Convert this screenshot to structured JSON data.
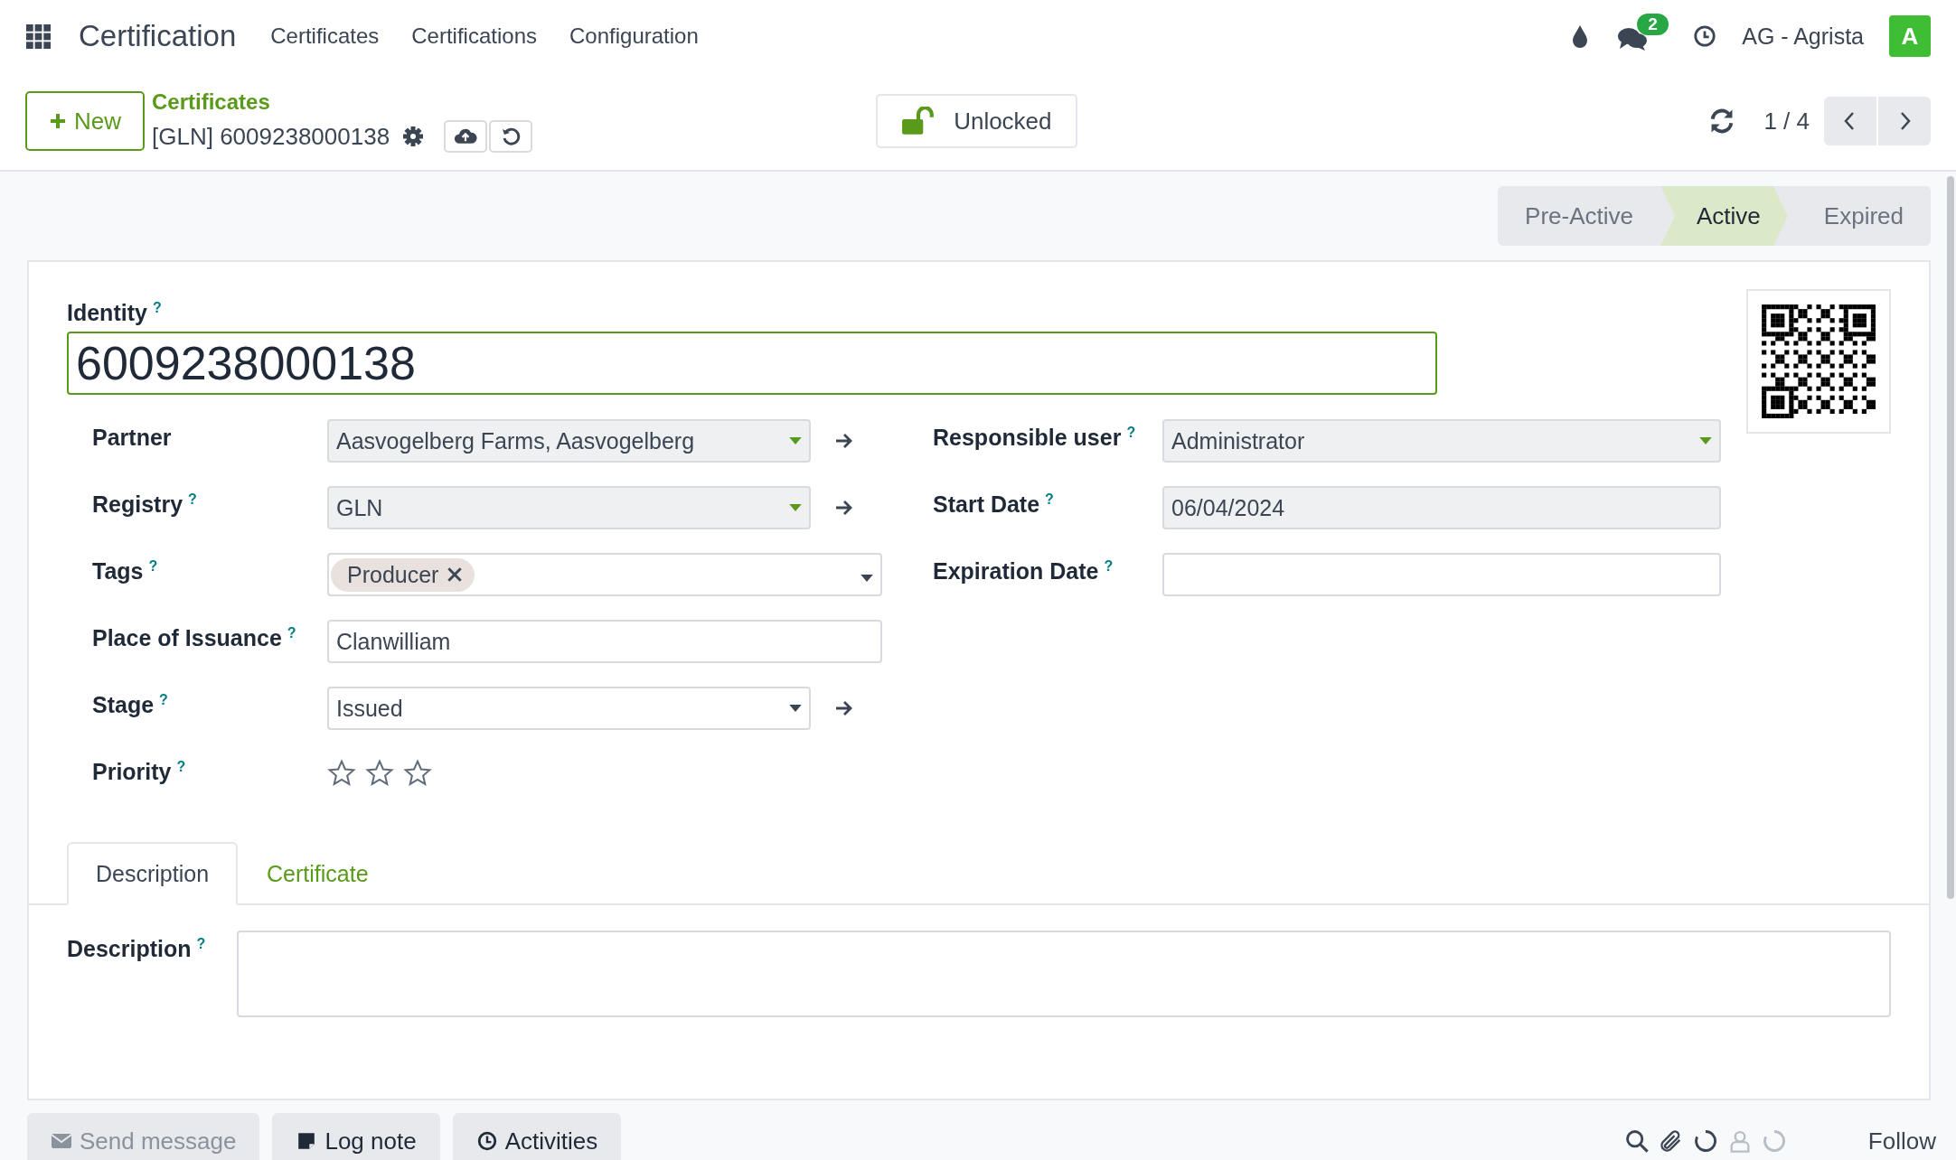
{
  "nav": {
    "app_name": "Certification",
    "menu": [
      "Certificates",
      "Certifications",
      "Configuration"
    ],
    "message_count": "2",
    "company": "AG - Agrista",
    "avatar_letter": "A"
  },
  "control_panel": {
    "new_button": "New",
    "breadcrumb": "Certificates",
    "record_name": "[GLN] 6009238000138",
    "lock_button": "Unlocked",
    "pager": "1 / 4"
  },
  "stages": [
    {
      "label": "Pre-Active",
      "selected": false
    },
    {
      "label": "Active",
      "selected": true
    },
    {
      "label": "Expired",
      "selected": false
    }
  ],
  "identity": {
    "label": "Identity",
    "help": "?",
    "value": "6009238000138"
  },
  "fields_left": [
    {
      "kind": "many2one",
      "label": "Partner",
      "value": "Aasvogelberg Farms, Aasvogelberg",
      "required": true,
      "open_link": true
    },
    {
      "kind": "many2one",
      "label": "Registry",
      "help": "?",
      "value": "GLN",
      "required": true,
      "open_link": true
    },
    {
      "kind": "tags",
      "label": "Tags",
      "help": "?",
      "tags": [
        "Producer"
      ]
    },
    {
      "kind": "text",
      "label": "Place of Issuance",
      "help": "?",
      "value": "Clanwilliam",
      "required": false
    },
    {
      "kind": "many2one",
      "label": "Stage",
      "help": "?",
      "value": "Issued",
      "required": false,
      "open_link": true
    },
    {
      "kind": "stars",
      "label": "Priority",
      "help": "?",
      "stars": 0
    }
  ],
  "fields_right": [
    {
      "kind": "many2one",
      "label": "Responsible user",
      "help": "?",
      "value": "Administrator",
      "required": true
    },
    {
      "kind": "text",
      "label": "Start Date",
      "help": "?",
      "value": "06/04/2024",
      "required": true
    },
    {
      "kind": "text",
      "label": "Expiration Date",
      "help": "?",
      "required": false
    }
  ],
  "tabs": [
    {
      "label": "Description",
      "selected": true
    },
    {
      "label": "Certificate",
      "selected": false
    }
  ],
  "description": {
    "label": "Description",
    "help": "?"
  },
  "chatter": {
    "buttons": [
      {
        "kind": "send",
        "label": "Send message",
        "muted": true
      },
      {
        "kind": "note",
        "label": "Log note",
        "muted": false
      },
      {
        "kind": "activity",
        "label": "Activities",
        "muted": false
      }
    ],
    "follow": "Follow"
  }
}
